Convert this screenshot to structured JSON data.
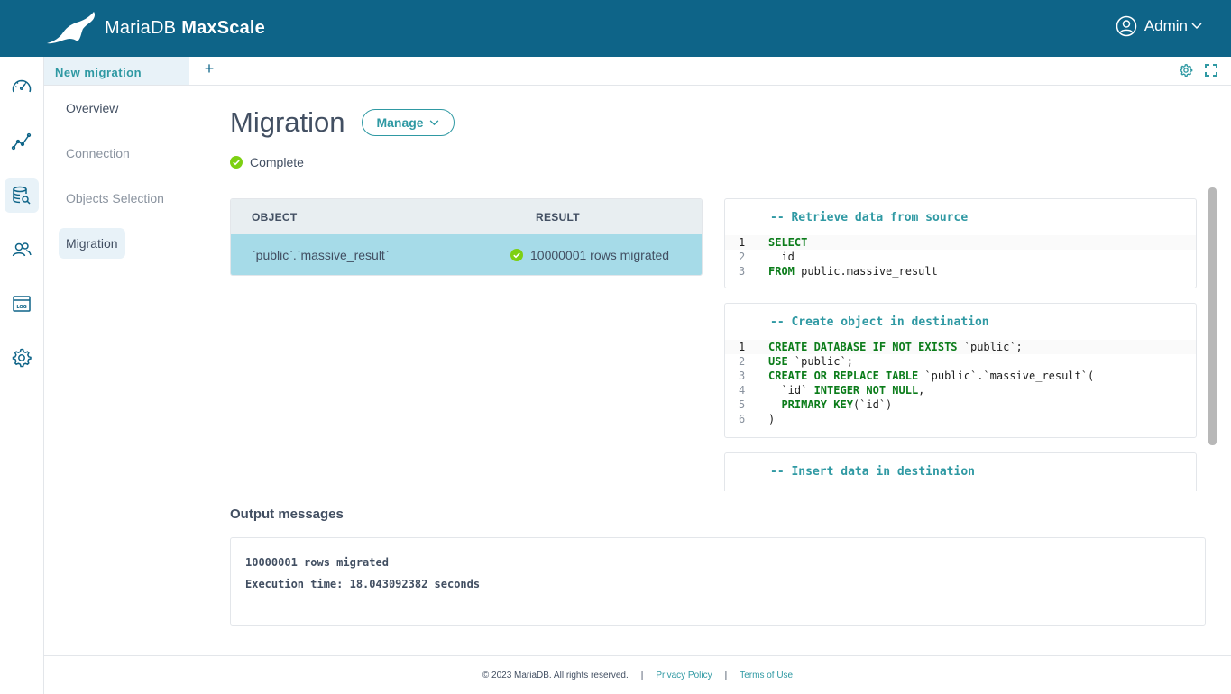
{
  "header": {
    "brand_main": "MariaDB",
    "brand_product": "MaxScale",
    "user_label": "Admin"
  },
  "tabs": {
    "active_label": "New migration",
    "add_label": "+"
  },
  "steps": [
    {
      "label": "Overview"
    },
    {
      "label": "Connection"
    },
    {
      "label": "Objects Selection"
    },
    {
      "label": "Migration"
    }
  ],
  "main": {
    "title": "Migration",
    "manage_label": "Manage",
    "status": "Complete"
  },
  "table": {
    "headers": [
      "OBJECT",
      "RESULT"
    ],
    "rows": [
      {
        "object": "`public`.`massive_result`",
        "result": "10000001 rows migrated"
      }
    ]
  },
  "sql": {
    "comments": [
      "-- Retrieve data from source",
      "-- Create object in destination",
      "-- Insert data in destination"
    ]
  },
  "output": {
    "title": "Output messages",
    "lines": [
      "10000001 rows migrated",
      "Execution time: 18.043092382 seconds"
    ]
  },
  "footer": {
    "copyright": "© 2023 MariaDB. All rights reserved.",
    "sep": "|",
    "privacy": "Privacy Policy",
    "terms": "Terms of Use"
  },
  "colors": {
    "header_bg": "#0e6488",
    "accent": "#2f99a3",
    "success": "#7dd012",
    "row_selected": "#a6dbe8"
  }
}
